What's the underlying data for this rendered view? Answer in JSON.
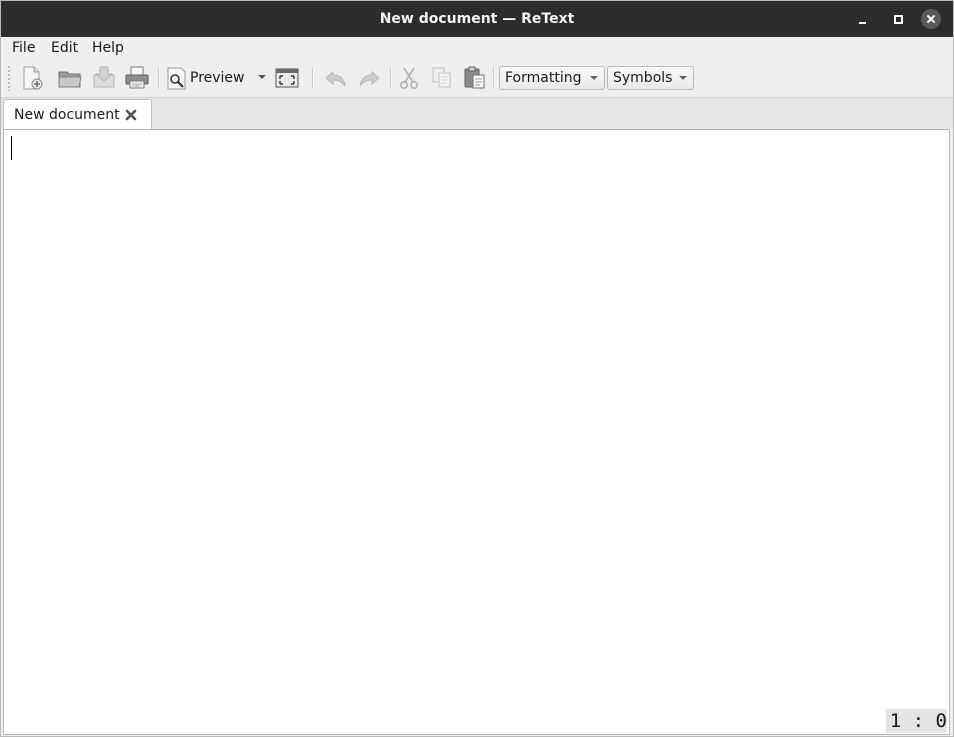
{
  "window": {
    "title": "New document — ReText"
  },
  "menubar": {
    "items": [
      {
        "label": "File"
      },
      {
        "label": "Edit"
      },
      {
        "label": "Help"
      }
    ]
  },
  "toolbar": {
    "buttons": [
      {
        "icon": "new-document-icon",
        "enabled": true
      },
      {
        "icon": "open-folder-icon",
        "enabled": true
      },
      {
        "icon": "save-icon",
        "enabled": false
      },
      {
        "icon": "print-icon",
        "enabled": true
      },
      {
        "icon": "preview-icon",
        "label": "Preview",
        "enabled": true
      },
      {
        "icon": "fullscreen-icon",
        "enabled": true
      },
      {
        "icon": "undo-icon",
        "enabled": false
      },
      {
        "icon": "redo-icon",
        "enabled": false
      },
      {
        "icon": "cut-icon",
        "enabled": false
      },
      {
        "icon": "copy-icon",
        "enabled": false
      },
      {
        "icon": "paste-icon",
        "enabled": true
      }
    ],
    "preview_label": "Preview",
    "formatting": {
      "value": "Formatting"
    },
    "symbols": {
      "value": "Symbols"
    }
  },
  "tabs": [
    {
      "label": "New document",
      "active": true
    }
  ],
  "editor": {
    "content": "",
    "cursor_position": "1 : 0"
  },
  "colors": {
    "titlebar": "#2c2c2c",
    "window_bg": "#efefef",
    "editor_bg": "#ffffff"
  }
}
